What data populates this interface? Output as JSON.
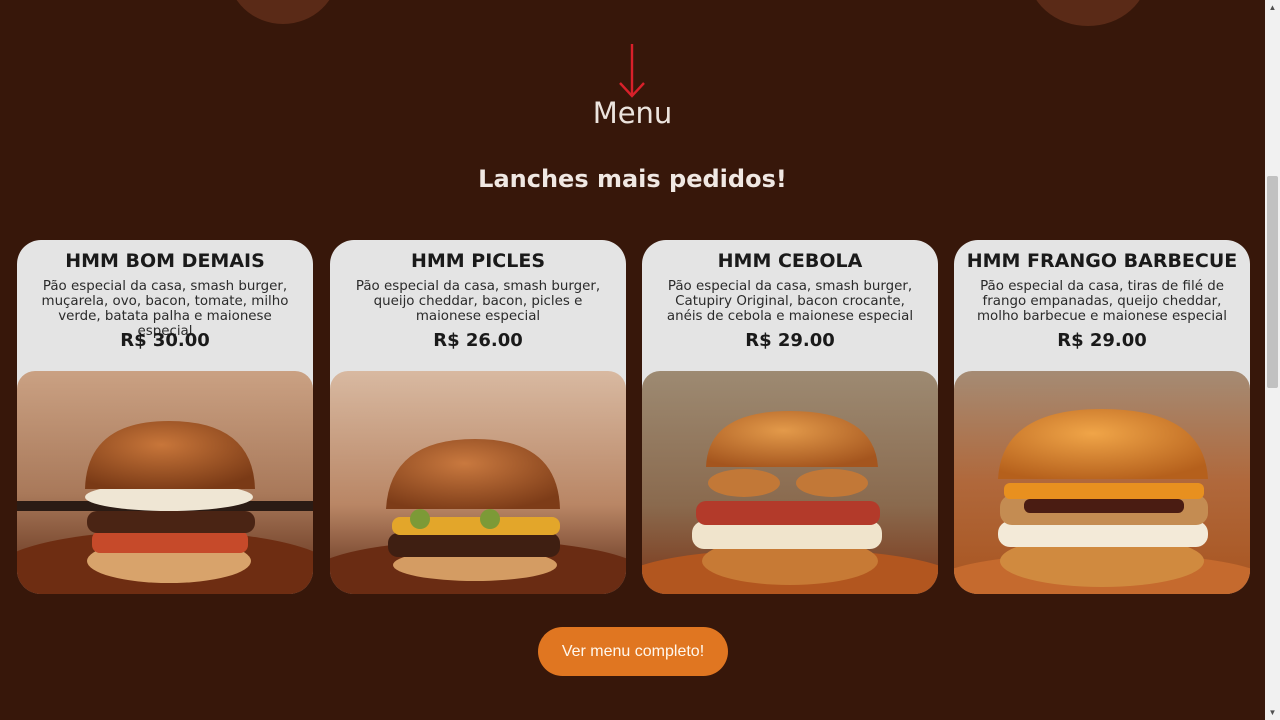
{
  "menu": {
    "heading": "Menu",
    "subheading": "Lanches mais pedidos!",
    "items": [
      {
        "name": "HMM BOM DEMAIS",
        "description": "Pão especial da casa, smash burger, muçarela, ovo, bacon, tomate, milho verde, batata palha e maionese especial",
        "price": "R$ 30.00"
      },
      {
        "name": "HMM PICLES",
        "description": "Pão especial da casa, smash burger, queijo cheddar, bacon, picles e maionese especial",
        "price": "R$ 26.00"
      },
      {
        "name": "HMM CEBOLA",
        "description": "Pão especial da casa, smash burger, Catupiry Original, bacon crocante, anéis de cebola e maionese especial",
        "price": "R$ 29.00"
      },
      {
        "name": "HMM FRANGO BARBECUE",
        "description": "Pão especial da casa, tiras de filé de frango empanadas, queijo cheddar, molho barbecue e maionese especial",
        "price": "R$ 29.00"
      }
    ],
    "cta_label": "Ver menu completo!"
  },
  "icons": {
    "arrow": "arrow-down-icon",
    "scroll_up": "scroll-up-arrow",
    "scroll_down": "scroll-down-arrow"
  },
  "colors": {
    "background": "#37170a",
    "accent": "#e07621",
    "arrow": "#d8202a",
    "card": "#e4e4e4"
  }
}
